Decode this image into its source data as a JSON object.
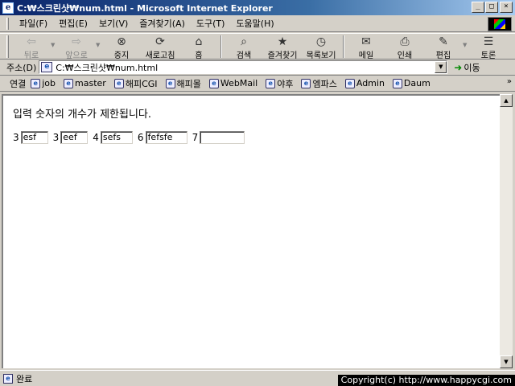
{
  "window": {
    "title": "C:₩스크린샷₩num.html - Microsoft Internet Explorer"
  },
  "menu": [
    "파일(F)",
    "편집(E)",
    "보기(V)",
    "즐겨찾기(A)",
    "도구(T)",
    "도움말(H)"
  ],
  "toolbar": {
    "back": "뒤로",
    "forward": "앞으로",
    "stop": "중지",
    "refresh": "새로고침",
    "home": "홈",
    "search": "검색",
    "favorites": "즐겨찾기",
    "history": "목록보기",
    "mail": "메일",
    "print": "인쇄",
    "edit": "편집",
    "discuss": "토론"
  },
  "address": {
    "label": "주소(D)",
    "value": "C:₩스크린샷₩num.html",
    "go": "이동"
  },
  "links": {
    "label": "연결",
    "items": [
      "job",
      "master",
      "해피CGI",
      "해피몰",
      "WebMail",
      "야후",
      "엠파스",
      "Admin",
      "Daum"
    ]
  },
  "page": {
    "heading": "입력 숫자의 개수가 제한됩니다.",
    "fields": [
      {
        "label": "3",
        "value": "esf"
      },
      {
        "label": "3",
        "value": "eef"
      },
      {
        "label": "4",
        "value": "sefs"
      },
      {
        "label": "6",
        "value": "fefsfe"
      },
      {
        "label": "7",
        "value": ""
      }
    ]
  },
  "status": {
    "text": "완료",
    "copyright": "Copyright(c) http://www.happycgi.com"
  }
}
